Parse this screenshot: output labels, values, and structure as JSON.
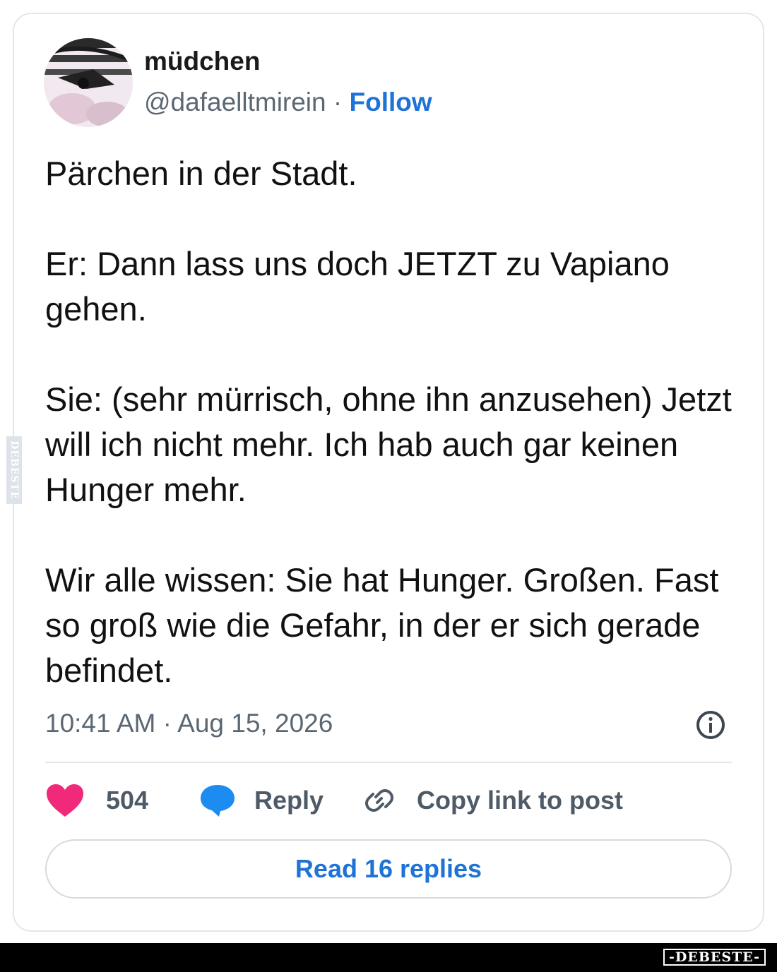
{
  "tweet": {
    "author_name": "müdchen",
    "handle": "@dafaelltmirein",
    "separator": " · ",
    "follow_label": "Follow",
    "paragraphs": [
      "Pärchen in der Stadt.",
      "Er: Dann lass uns doch JETZT zu Vapiano gehen.",
      "Sie: (sehr mürrisch, ohne ihn anzusehen) Jetzt will ich nicht mehr. Ich hab auch gar keinen Hunger mehr.",
      "Wir alle wissen: Sie hat Hunger. Großen. Fast so groß wie die Gefahr, in der er sich gerade befindet."
    ],
    "timestamp": "10:41 AM · Aug 15, 2026"
  },
  "actions": {
    "like_count": "504",
    "reply_label": "Reply",
    "copy_link_label": "Copy link to post",
    "read_replies_label": "Read 16 replies"
  },
  "watermark": {
    "side_text": "DEBESTE",
    "footer_text": "-DEBESTE-"
  },
  "icons": {
    "heart": "heart-icon",
    "reply": "speech-bubble-icon",
    "copy": "link-icon",
    "info": "info-icon"
  },
  "colors": {
    "accent_blue": "#1d73d6",
    "heart_pink": "#f0297a",
    "reply_blue": "#1d8cf0",
    "muted_text": "#5b6773",
    "border": "#e3e6ea"
  }
}
